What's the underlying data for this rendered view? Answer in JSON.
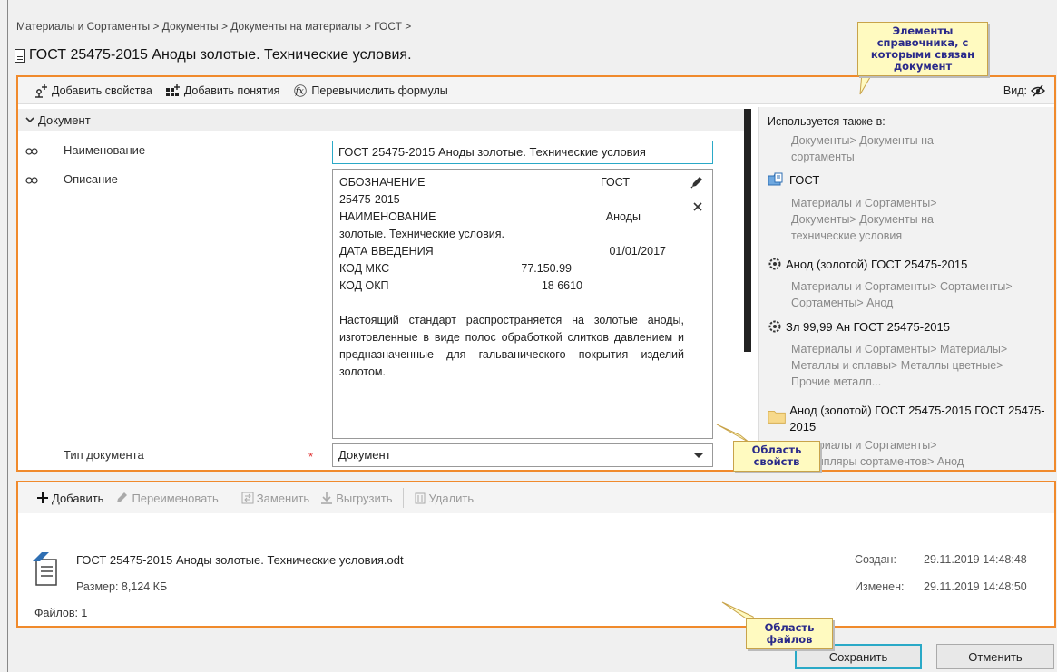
{
  "breadcrumb": "Материалы и Сортаменты > Документы > Документы на материалы > ГОСТ >",
  "document_title": "ГОСТ 25475-2015 Аноды золотые. Технические условия.",
  "toolbar": {
    "add_properties": "Добавить свойства",
    "add_concepts": "Добавить понятия",
    "recalc_formulas": "Перевычислить формулы",
    "view_label": "Вид:"
  },
  "section": {
    "title": "Документ"
  },
  "fields": {
    "name_label": "Наименование",
    "name_value": "ГОСТ 25475-2015 Аноды золотые. Технические условия",
    "desc_label": "Описание",
    "type_label": "Тип документа",
    "required_mark": "*",
    "type_value": "Документ"
  },
  "description": {
    "designation_key": "ОБОЗНАЧЕНИЕ",
    "designation_val": "ГОСТ",
    "designation_cont": "25475-2015",
    "name_key": "НАИМЕНОВАНИЕ",
    "name_val": "Аноды",
    "name_cont": "золотые. Технические условия.",
    "date_key": "ДАТА ВВЕДЕНИЯ",
    "date_val": "01/01/2017",
    "mks_key": "КОД МКС",
    "mks_val": "77.150.99",
    "okp_key": "КОД ОКП",
    "okp_val": "18 6610",
    "paragraph": "Настоящий стандарт распространяется на золотые аноды, изготовленные в виде полос обработкой слитков давлением и предназначенные для гальванического покрытия изделий золотом."
  },
  "related": {
    "header": "Используется также в:",
    "first_path": "Документы> Документы на сортаменты",
    "items": [
      {
        "title": "ГОСТ",
        "icon": "folder-doc-icon",
        "path": "Материалы и Сортаменты> Документы> Документы на технические условия"
      },
      {
        "title": "Анод (золотой) ГОСТ 25475-2015",
        "icon": "gear-link-icon",
        "path": "Материалы и Сортаменты> Сортаменты> Сортаменты> Анод"
      },
      {
        "title": "Зл 99,99 Ан ГОСТ 25475-2015",
        "icon": "gear-link-icon",
        "path": "Материалы и Сортаменты> Материалы> Металлы и сплавы> Металлы цветные> Прочие металл..."
      },
      {
        "title": "Анод (золотой) ГОСТ 25475-2015 ГОСТ 25475-2015",
        "icon": "folder-icon",
        "path": "Материалы и Сортаменты> Экземпляры сортаментов> Анод"
      }
    ]
  },
  "files_toolbar": {
    "add": "Добавить",
    "rename": "Переименовать",
    "replace": "Заменить",
    "export": "Выгрузить",
    "delete": "Удалить"
  },
  "file": {
    "name": "ГОСТ 25475-2015 Аноды золотые. Технические условия.odt",
    "size": "Размер: 8,124 КБ",
    "created_label": "Создан:",
    "created_value": "29.11.2019 14:48:48",
    "modified_label": "Изменен:",
    "modified_value": "29.11.2019 14:48:50"
  },
  "files_count": "Файлов: 1",
  "buttons": {
    "save": "Сохранить",
    "cancel": "Отменить"
  },
  "callouts": {
    "elements": "Элементы справочника, с которыми связан документ",
    "properties": "Область свойств",
    "files": "Область файлов"
  },
  "colors": {
    "accent_frame": "#f08a2c",
    "focus": "#2aa9c7",
    "callout_bg": "#fffac0"
  }
}
